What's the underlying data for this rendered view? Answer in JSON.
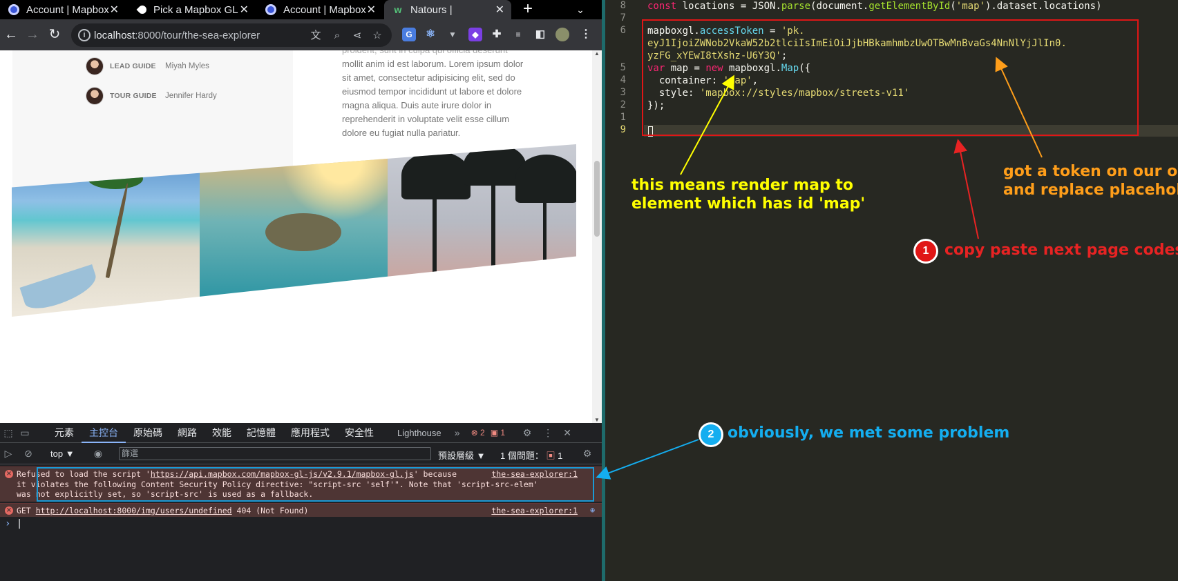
{
  "browser": {
    "tabs": [
      {
        "label": "Account | Mapbox",
        "active": false,
        "favicon": "mapbox-icon"
      },
      {
        "label": "Pick a Mapbox GL",
        "active": false,
        "favicon": "mapbox-pin-icon"
      },
      {
        "label": "Account | Mapbox",
        "active": false,
        "favicon": "mapbox-icon"
      },
      {
        "label": "Natours |",
        "active": true,
        "favicon": "natours-icon"
      }
    ],
    "url_host": "localhost",
    "url_rest": ":8000/tour/the-sea-explorer"
  },
  "page": {
    "guides": [
      {
        "role": "LEAD GUIDE",
        "name": "Miyah Myles"
      },
      {
        "role": "TOUR GUIDE",
        "name": "Jennifer Hardy"
      }
    ],
    "paragraph_cut": "proident, sunt in culpa qui officia deserunt",
    "paragraph": "mollit anim id est laborum. Lorem ipsum dolor sit amet, consectetur adipisicing elit, sed do eiusmod tempor incididunt ut labore et dolore magna aliqua. Duis aute irure dolor in reprehenderit in voluptate velit esse cillum dolore eu fugiat nulla pariatur."
  },
  "devtools": {
    "tabs": [
      "元素",
      "主控台",
      "原始碼",
      "網路",
      "效能",
      "記憶體",
      "應用程式",
      "安全性",
      "Lighthouse"
    ],
    "active_tab": "主控台",
    "error_count": "2",
    "issue_count": "1",
    "context": "top",
    "filter_placeholder": "篩選",
    "levels": "預設層級",
    "issues_label": "1 個問題：",
    "issues_count": "1",
    "messages": [
      {
        "text_prefix": "Refused to load the script '",
        "link": "https://api.mapbox.com/mapbox-gl-js/v2.9.1/mapbox-gl.js",
        "text_line1_end": "' because",
        "text_line2": "it violates the following Content Security Policy directive: \"script-src 'self'\". Note that 'script-src-elem'",
        "text_line3": "was not explicitly set, so 'script-src' is used as a fallback.",
        "source": "the-sea-explorer:1"
      },
      {
        "method": "GET",
        "link": "http://localhost:8000/img/users/undefined",
        "status": "404 (Not Found)",
        "source": "the-sea-explorer:1"
      }
    ]
  },
  "editor": {
    "line_numbers": [
      "8",
      "7",
      "6",
      "",
      "",
      "5",
      "4",
      "3",
      "2",
      "1",
      "9"
    ],
    "current_line": "9"
  },
  "annotations": {
    "yellow": [
      "this means render map to",
      "element which has id 'map'"
    ],
    "orange": [
      "got a token on our own",
      "and replace placeholder"
    ],
    "red_number": "1",
    "red": "copy paste next page codes",
    "blue_number": "2",
    "blue": "obviously, we met some problem"
  },
  "colors": {
    "yellow": "#ffff00",
    "orange": "#ff9e1a",
    "red": "#e82323",
    "blue": "#14aef0",
    "editor_bg": "#272822",
    "devtools_error_bg": "#4e3534"
  }
}
